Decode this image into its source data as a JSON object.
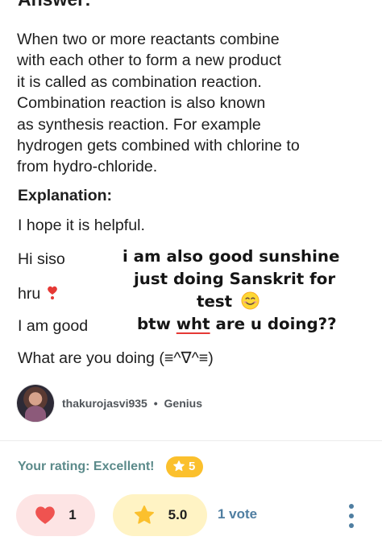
{
  "answer": {
    "heading": "Answer:",
    "body_lines": [
      "When two or more reactants combine",
      "with each other to form a new product",
      "it is called as combination reaction.",
      "Combination reaction is also known",
      "as synthesis reaction. For example",
      "hydrogen gets combined with chlorine to",
      "from hydro-chloride."
    ],
    "explanation_label": "Explanation:",
    "helpful_line": "I hope it is helpful."
  },
  "chat": {
    "left_1": "Hi siso",
    "left_2": "hru",
    "left_3": "I am good",
    "left_4": "What are you doing (≡^∇^≡)",
    "hand_1": "i am also good sunshine",
    "hand_2a": "just doing Sanskrit for",
    "hand_2b": "test",
    "hand_3a": "btw ",
    "hand_3b": "wht",
    "hand_3c": " are u doing??"
  },
  "author": {
    "username": "thakurojasvi935",
    "separator": "•",
    "rank": "Genius"
  },
  "rating": {
    "label": "Your rating: Excellent!",
    "value": "5"
  },
  "actions": {
    "thanks_count": "1",
    "rating_average": "5.0",
    "votes": "1 vote"
  },
  "colors": {
    "accent_teal": "#5b8a8a",
    "link_blue": "#4f7ea1",
    "star_yellow": "#fbc02d",
    "heart_red": "#ef5350",
    "thanks_bg": "#fde4e4",
    "rate_bg": "#fff3c4"
  },
  "icons": [
    "heart-emoji",
    "smile-emoji",
    "star-icon",
    "heart-icon",
    "more-icon"
  ]
}
